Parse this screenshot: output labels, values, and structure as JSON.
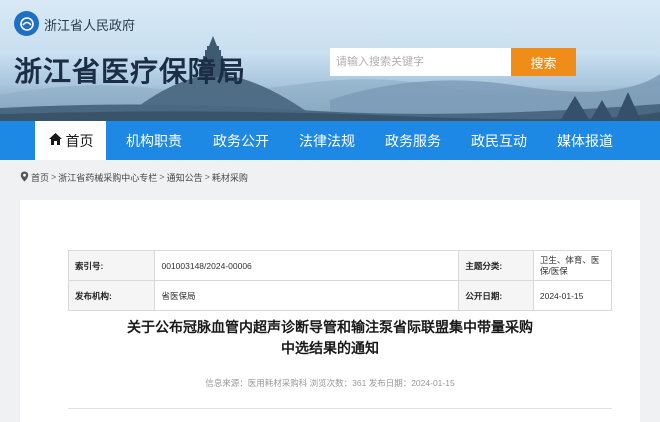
{
  "header": {
    "gov_name": "浙江省人民政府",
    "site_title": "浙江省医疗保障局",
    "search": {
      "placeholder": "请输入搜索关键字",
      "button_label": "搜索"
    }
  },
  "nav": {
    "items": [
      {
        "label": "首页",
        "active": true
      },
      {
        "label": "机构职责"
      },
      {
        "label": "政务公开"
      },
      {
        "label": "法律法规"
      },
      {
        "label": "政务服务"
      },
      {
        "label": "政民互动"
      },
      {
        "label": "媒体报道"
      }
    ]
  },
  "breadcrumb": {
    "items": [
      "首页",
      "浙江省药械采购中心专栏",
      "通知公告",
      "耗材采购"
    ],
    "separator": ">"
  },
  "meta": {
    "index_label": "索引号:",
    "index_value": "001003148/2024-00006",
    "topic_label": "主题分类:",
    "topic_value": "卫生、体育、医保/医保",
    "org_label": "发布机构:",
    "org_value": "省医保局",
    "date_label": "公开日期:",
    "date_value": "2024-01-15"
  },
  "document": {
    "title_line1": "关于公布冠脉血管内超声诊断导管和输注泵省际联盟集中带量采购",
    "title_line2": "中选结果的通知",
    "info": "信息来源：医用耗材采购科 浏览次数：361 发布日期：2024-01-15"
  },
  "colors": {
    "nav_blue": "#1e88e5",
    "search_orange": "#f08c18",
    "logo_blue": "#1f6fc5"
  }
}
